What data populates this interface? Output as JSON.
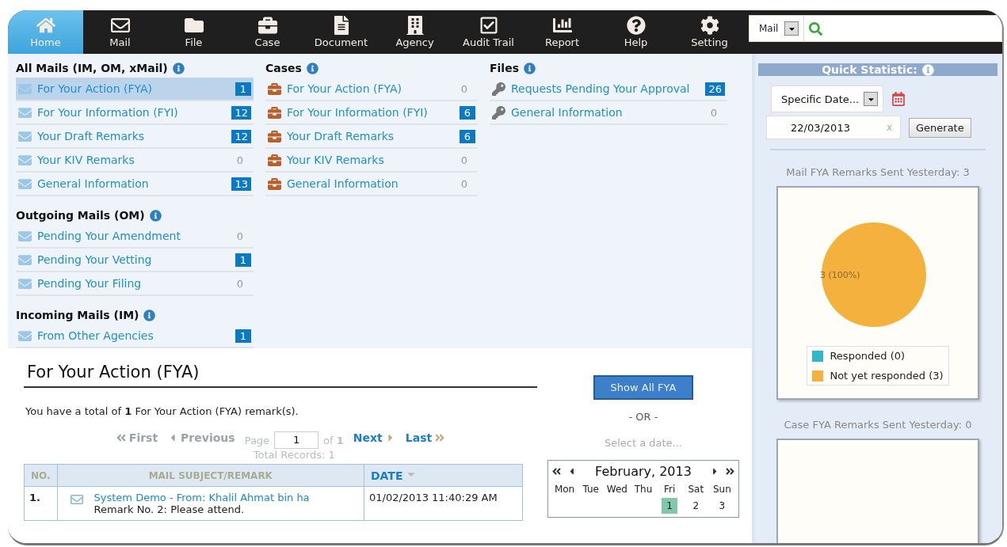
{
  "nav": {
    "items": [
      {
        "label": "Home",
        "selected": true
      },
      {
        "label": "Mail",
        "selected": false
      },
      {
        "label": "File",
        "selected": false
      },
      {
        "label": "Case",
        "selected": false
      },
      {
        "label": "Document",
        "selected": false
      },
      {
        "label": "Agency",
        "selected": false
      },
      {
        "label": "Audit Trail",
        "selected": false
      },
      {
        "label": "Report",
        "selected": false
      },
      {
        "label": "Help",
        "selected": false
      },
      {
        "label": "Setting",
        "selected": false
      }
    ],
    "search": {
      "scope": "Mail"
    }
  },
  "columns": [
    {
      "groups": [
        {
          "title": "All Mails (IM, OM, xMail)",
          "items": [
            {
              "label": "For Your Action (FYA)",
              "count": "1",
              "kind": "badge",
              "selected": true
            },
            {
              "label": "For Your Information (FYI)",
              "count": "12",
              "kind": "badge",
              "selected": false
            },
            {
              "label": "Your Draft Remarks",
              "count": "12",
              "kind": "badge",
              "selected": false
            },
            {
              "label": "Your KIV Remarks",
              "count": "0",
              "kind": "plain",
              "selected": false
            },
            {
              "label": "General Information",
              "count": "13",
              "kind": "badge",
              "selected": false
            }
          ]
        },
        {
          "title": "Outgoing Mails (OM)",
          "items": [
            {
              "label": "Pending Your Amendment",
              "count": "0",
              "kind": "plain",
              "selected": false
            },
            {
              "label": "Pending Your Vetting",
              "count": "1",
              "kind": "badge",
              "selected": false
            },
            {
              "label": "Pending Your Filing",
              "count": "0",
              "kind": "plain",
              "selected": false
            }
          ]
        },
        {
          "title": "Incoming Mails (IM)",
          "items": [
            {
              "label": "From Other Agencies",
              "count": "1",
              "kind": "badge",
              "selected": false
            }
          ]
        }
      ]
    },
    {
      "groups": [
        {
          "title": "Cases",
          "items": [
            {
              "label": "For Your Action (FYA)",
              "count": "0",
              "kind": "plain",
              "selected": false
            },
            {
              "label": "For Your Information (FYI)",
              "count": "6",
              "kind": "badge",
              "selected": false
            },
            {
              "label": "Your Draft Remarks",
              "count": "6",
              "kind": "badge",
              "selected": false
            },
            {
              "label": "Your KIV Remarks",
              "count": "0",
              "kind": "plain",
              "selected": false
            },
            {
              "label": "General Information",
              "count": "0",
              "kind": "plain",
              "selected": false
            }
          ]
        }
      ]
    },
    {
      "groups": [
        {
          "title": "Files",
          "items": [
            {
              "label": "Requests Pending Your Approval",
              "count": "26",
              "kind": "badge",
              "selected": false
            },
            {
              "label": "General Information",
              "count": "0",
              "kind": "plain",
              "selected": false
            }
          ]
        }
      ]
    }
  ],
  "fya": {
    "title": "For Your Action (FYA)",
    "summary": "You have a total of **1** For Your Action (FYA) remark(s).",
    "back_links": [
      {
        "label": "First",
        "disabled": true
      },
      {
        "label": "Previous",
        "disabled": true
      }
    ],
    "page_label": "Page",
    "page": "1",
    "of": "of **1**",
    "total": "Total Records: 1",
    "forward_links": [
      {
        "label": "Next",
        "disabled": false
      },
      {
        "label": "Last",
        "disabled": false
      }
    ],
    "table": {
      "columns": [
        {
          "label": "NO.",
          "sorted": false
        },
        {
          "label": "MAIL SUBJECT/REMARK",
          "sorted": false
        },
        {
          "label": "DATE",
          "sorted": true
        }
      ],
      "rows": [
        {
          "no": "1.",
          "subject": "System Demo - From: Khalil Ahmat bin ha",
          "remark": "Remark No. 2: Please attend.",
          "date": "01/02/2013 11:40:29 AM"
        }
      ]
    }
  },
  "picker": {
    "button": "Show All FYA",
    "or": "- OR -",
    "hint": "Select a date...",
    "calendar": {
      "month": "February, 2013",
      "weekdays": [
        "Mon",
        "Tue",
        "Wed",
        "Thu",
        "Fri",
        "Sat",
        "Sun"
      ],
      "days": [
        {
          "label": "1",
          "selected": true
        },
        {
          "label": "2",
          "selected": false
        },
        {
          "label": "3",
          "selected": false
        }
      ]
    }
  },
  "stats": {
    "title": "Quick Statistic:",
    "range": "Specific Date...",
    "date": "22/03/2013",
    "clear": "x",
    "generate": "Generate",
    "charts": [
      {
        "chart_data": {
          "type": "pie",
          "title": "Mail FYA Remarks Sent Yesterday: 3",
          "value_labels": [
            "3 (100%)"
          ],
          "categories": [
            "Responded (0)",
            "Not yet responded (3)"
          ],
          "series": [
            {
              "values": [
                0,
                3
              ]
            }
          ]
        },
        "slice_colors": [
          {
            "color": "#2fb8c9"
          },
          {
            "color": "#f5b13d"
          }
        ]
      },
      {
        "title": "Case FYA Remarks Sent Yesterday: 0"
      }
    ]
  }
}
